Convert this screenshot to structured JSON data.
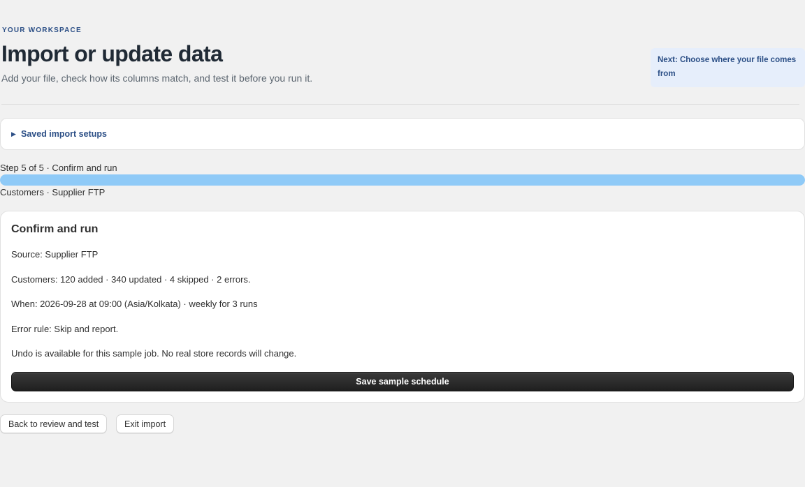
{
  "header": {
    "eyebrow": "YOUR WORKSPACE",
    "title": "Import or update data",
    "subtitle": "Add your file, check how its columns match, and test it before you run it.",
    "next_hint": "Next: Choose where your file comes from"
  },
  "saved_setups": {
    "label": "Saved import setups",
    "expanded": false
  },
  "progress": {
    "step_label": "Step 5 of 5 · Confirm and run",
    "current_step": 5,
    "total_steps": 5,
    "fraction": 1.0,
    "context": "Customers · Supplier FTP",
    "fill_color": "#8fcaf7"
  },
  "confirm": {
    "title": "Confirm and run",
    "lines": [
      "Source: Supplier FTP",
      "Customers: 120 added · 340 updated · 4 skipped · 2 errors.",
      "When: 2026-09-28 at 09:00 (Asia/Kolkata) · weekly for 3 runs",
      "Error rule: Skip and report.",
      "Undo is available for this sample job. No real store records will change."
    ],
    "primary_button": "Save sample schedule"
  },
  "footer": {
    "back_button": "Back to review and test",
    "exit_button": "Exit import"
  },
  "colors": {
    "accent": "#2c4f86",
    "primary_button": "#2a2a2a",
    "page_background": "#f1f1f1"
  }
}
